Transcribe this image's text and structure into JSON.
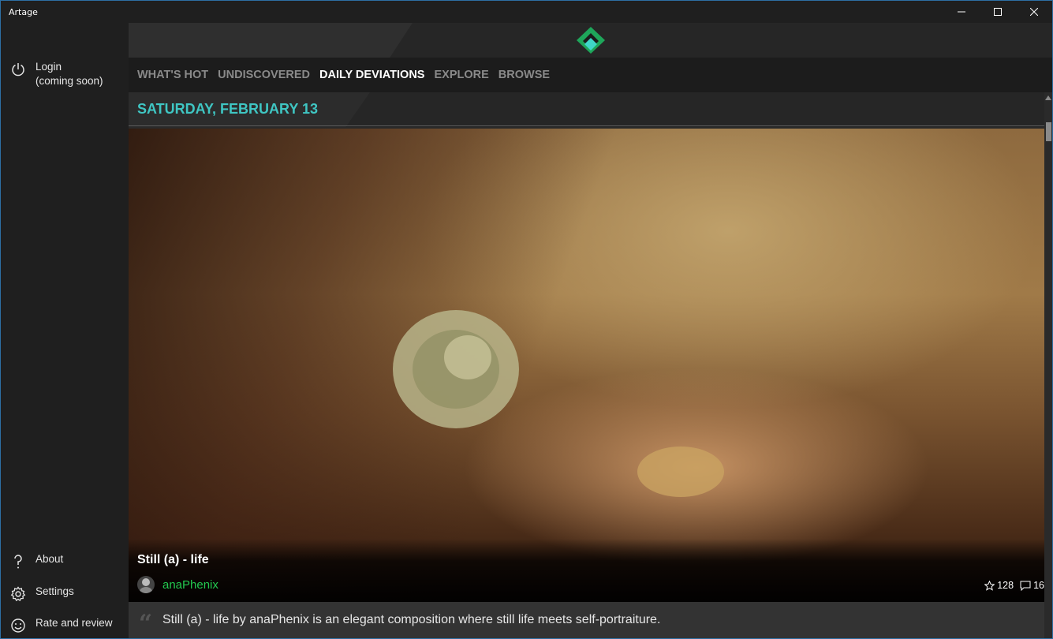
{
  "window": {
    "title": "Artage"
  },
  "sidebar": {
    "login": {
      "line1": "Login",
      "line2": "(coming soon)",
      "icon": "power-icon"
    },
    "about": {
      "label": "About",
      "icon": "question-icon"
    },
    "settings": {
      "label": "Settings",
      "icon": "gear-icon"
    },
    "rate": {
      "label": "Rate and review",
      "icon": "smiley-icon"
    }
  },
  "nav": {
    "items": [
      {
        "label": "WHAT'S HOT"
      },
      {
        "label": "UNDISCOVERED"
      },
      {
        "label": "DAILY DEVIATIONS"
      },
      {
        "label": "EXPLORE"
      },
      {
        "label": "BROWSE"
      }
    ],
    "active_index": 2
  },
  "feed": {
    "date": "SATURDAY, FEBRUARY 13",
    "deviation": {
      "title": "Still (a) - life",
      "author": "anaPhenix",
      "favourites": "128",
      "comments": "16",
      "description": "Still (a) - life by anaPhenix is an elegant composition where still life meets self-portraiture."
    }
  },
  "colors": {
    "accent_teal": "#3fc6c3",
    "author_green": "#22c84f",
    "logo_green": "#1ea65a"
  }
}
